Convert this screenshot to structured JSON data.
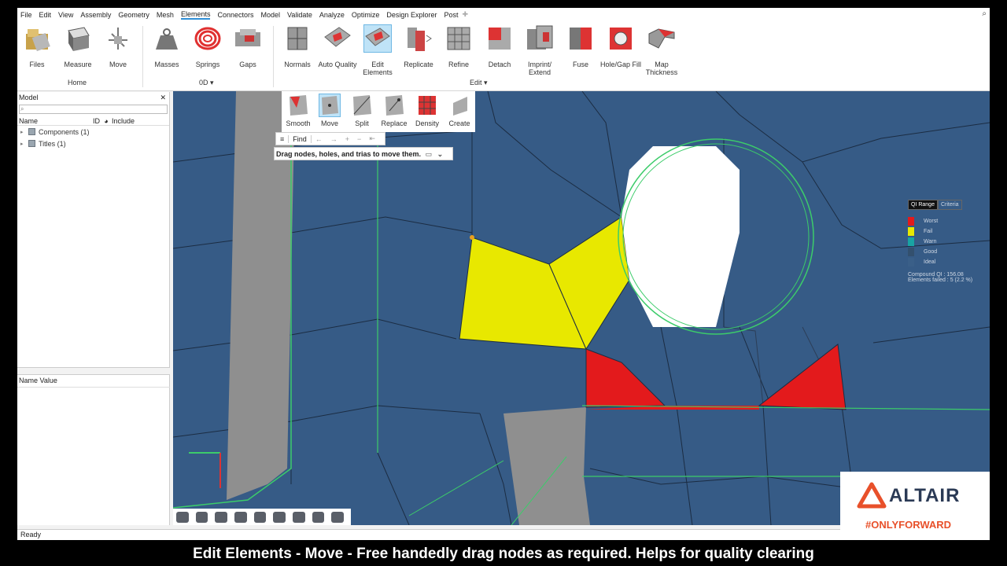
{
  "menu": [
    "File",
    "Edit",
    "View",
    "Assembly",
    "Geometry",
    "Mesh",
    "Elements",
    "Connectors",
    "Model",
    "Validate",
    "Analyze",
    "Optimize",
    "Design Explorer",
    "Post"
  ],
  "active_menu": "Elements",
  "ribbon": {
    "tools": [
      {
        "label": "Files",
        "icon": "files-icon"
      },
      {
        "label": "Measure",
        "icon": "measure-icon"
      },
      {
        "label": "Move",
        "icon": "move-icon"
      },
      {
        "label": "Masses",
        "icon": "masses-icon"
      },
      {
        "label": "Springs",
        "icon": "springs-icon"
      },
      {
        "label": "Gaps",
        "icon": "gaps-icon"
      },
      {
        "label": "Normals",
        "icon": "normals-icon"
      },
      {
        "label": "Auto Quality",
        "icon": "auto-quality-icon"
      },
      {
        "label": "Edit\nElements",
        "icon": "edit-elements-icon"
      },
      {
        "label": "Replicate",
        "icon": "replicate-icon"
      },
      {
        "label": "Refine",
        "icon": "refine-icon"
      },
      {
        "label": "Detach",
        "icon": "detach-icon"
      },
      {
        "label": "Imprint/\nExtend",
        "icon": "imprint-extend-icon"
      },
      {
        "label": "Fuse",
        "icon": "fuse-icon"
      },
      {
        "label": "Hole/Gap Fill",
        "icon": "hole-gap-fill-icon"
      },
      {
        "label": "Map\nThickness",
        "icon": "map-thickness-icon"
      }
    ],
    "groups": {
      "home": "Home",
      "zero_d": "0D ▾",
      "edit": "Edit ▾"
    }
  },
  "model_panel": {
    "title": "Model",
    "columns": [
      "Name",
      "ID",
      "Include"
    ],
    "items": [
      "Components (1)",
      "Titles (1)"
    ],
    "name_value_header": "Name Value"
  },
  "subtools": [
    {
      "label": "Smooth",
      "icon": "smooth-icon"
    },
    {
      "label": "Move",
      "icon": "move-node-icon"
    },
    {
      "label": "Split",
      "icon": "split-icon"
    },
    {
      "label": "Replace",
      "icon": "replace-icon"
    },
    {
      "label": "Density",
      "icon": "density-icon"
    },
    {
      "label": "Create",
      "icon": "create-icon"
    }
  ],
  "find_label": "Find",
  "tooltip": "Drag nodes, holes, and trias to move them.",
  "legend": {
    "tabs": [
      "QI Range",
      "Criteria"
    ],
    "entries": [
      {
        "label": "Worst",
        "color": "#e31a1c"
      },
      {
        "label": "Fail",
        "color": "#e8e800"
      },
      {
        "label": "Warn",
        "color": "#19a3a3"
      },
      {
        "label": "Good",
        "color": "#33506e"
      },
      {
        "label": "Ideal",
        "color": "#3a5f88"
      }
    ],
    "compound": "Compound QI : 156.08",
    "failed": "Elements failed : 5 (2.2 %)"
  },
  "status": "Ready",
  "logo": {
    "brand": "ALTAIR",
    "slogan": "#ONLYFORWARD"
  },
  "caption": "Edit Elements - Move - Free handedly drag nodes as required. Helps for quality clearing"
}
